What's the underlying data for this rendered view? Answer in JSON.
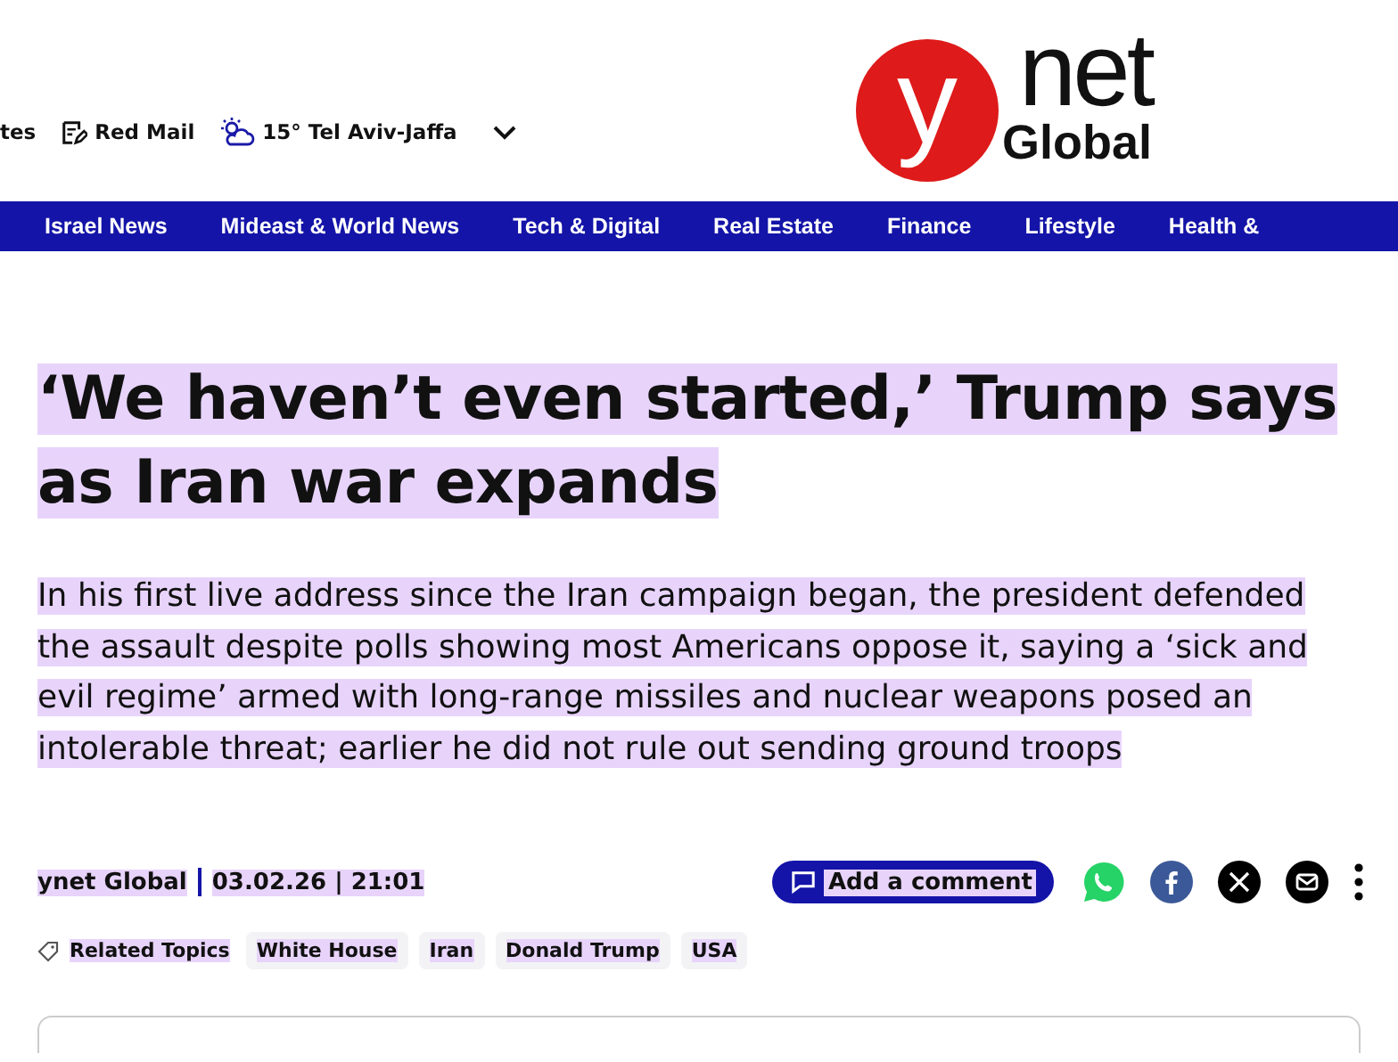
{
  "utility_bar": {
    "items": [
      {
        "kind": "text",
        "label": "tes"
      },
      {
        "kind": "mail",
        "label": "Red Mail"
      },
      {
        "kind": "weather",
        "label": "15° Tel Aviv-Jaffa"
      }
    ]
  },
  "logo": {
    "letter": "y",
    "word": "net",
    "subtitle": "Global"
  },
  "nav": [
    "Israel News",
    "Mideast & World News",
    "Tech & Digital",
    "Real Estate",
    "Finance",
    "Lifestyle",
    "Health &"
  ],
  "article": {
    "headline": "‘We haven’t even started,’ Trump says as Iran war expands",
    "subtitle": "In his first live address since the Iran campaign began, the president defended the assault despite polls showing most Americans oppose it, saying a ‘sick and evil regime’ armed with long-range missiles and nuclear weapons posed an intolerable threat; earlier he did not rule out sending ground troops",
    "author": "ynet Global",
    "datetime": "03.02.26 | 21:01",
    "comment_button": "Add a comment",
    "share": [
      {
        "kind": "whatsapp"
      },
      {
        "kind": "facebook"
      },
      {
        "kind": "x"
      },
      {
        "kind": "email"
      }
    ],
    "related_label": "Related Topics",
    "topics": [
      "White House",
      "Iran",
      "Donald Trump",
      "USA"
    ]
  }
}
